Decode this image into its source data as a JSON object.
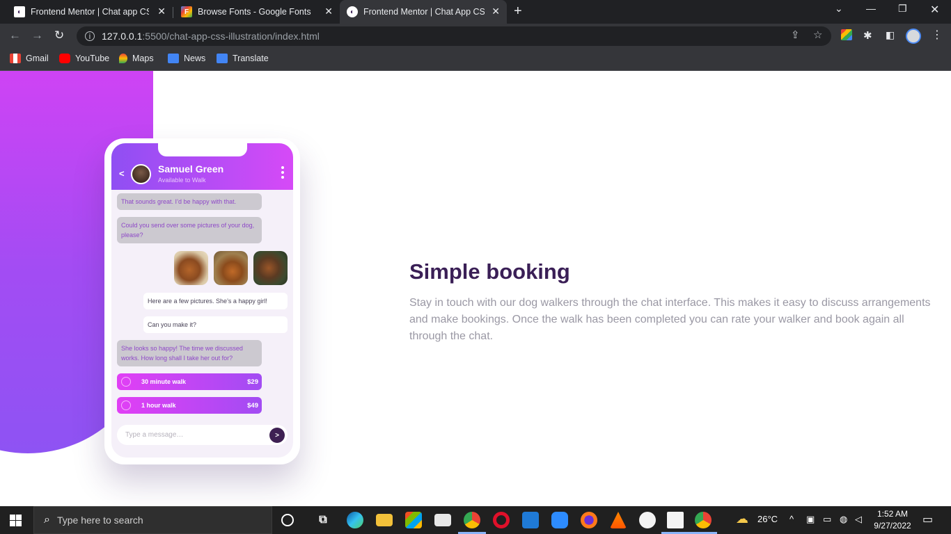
{
  "browser": {
    "tabs": [
      {
        "title": "Frontend Mentor | Chat app CSS",
        "active": false
      },
      {
        "title": "Browse Fonts - Google Fonts",
        "active": false
      },
      {
        "title": "Frontend Mentor | Chat App CSS",
        "active": true
      }
    ],
    "url_host": "127.0.0.1",
    "url_path": ":5500/chat-app-css-illustration/index.html",
    "bookmarks": [
      "Gmail",
      "YouTube",
      "Maps",
      "News",
      "Translate"
    ]
  },
  "chat": {
    "contact_name": "Samuel Green",
    "contact_status": "Available to Walk",
    "messages": [
      {
        "dir": "in",
        "text": "That sounds great. I’d be happy with that."
      },
      {
        "dir": "in",
        "text": "Could you send over some pictures of your dog, please?"
      },
      {
        "dir": "out",
        "text": "Here are a few pictures. She’s a happy girl!"
      },
      {
        "dir": "out",
        "text": "Can you make it?"
      },
      {
        "dir": "in",
        "text": "She looks so happy! The time we discussed works. How long shall I take her out for?"
      }
    ],
    "offers": [
      {
        "label": "30 minute walk",
        "price": "$29"
      },
      {
        "label": "1 hour walk",
        "price": "$49"
      }
    ],
    "input_placeholder": "Type a message…"
  },
  "content": {
    "headline": "Simple booking",
    "description": "Stay in touch with our dog walkers through the chat interface. This makes it easy to discuss arrangements and make bookings. Once the walk has been completed you can rate your walker and book again all through the chat."
  },
  "taskbar": {
    "search_placeholder": "Type here to search",
    "weather": "26°C",
    "time": "1:52 AM",
    "date": "9/27/2022"
  },
  "colors": {
    "gradient_start": "#e13ff5",
    "gradient_end": "#8f4ff3",
    "headline": "#3a1f56",
    "body_text": "#9a98a4"
  }
}
